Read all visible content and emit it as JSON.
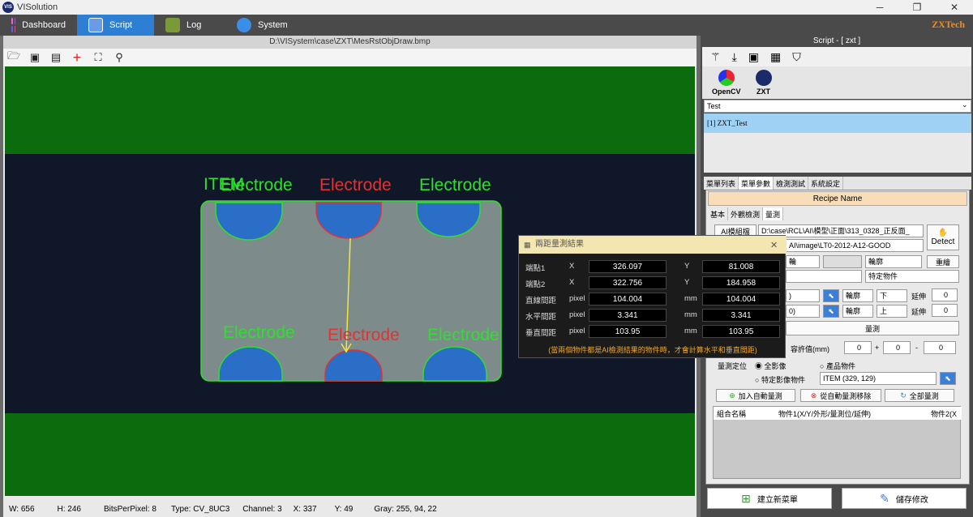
{
  "app": {
    "title": "VISolution",
    "logo_text": "VIS",
    "brand": "ZXTech",
    "win_minimize": "─",
    "win_restore": "❐",
    "win_close": "✕"
  },
  "menu": [
    {
      "label": "Dashboard",
      "icon": "dashboard-icon",
      "color": "#c04fc9"
    },
    {
      "label": "Script",
      "icon": "script-icon",
      "color": "#3a6bd6"
    },
    {
      "label": "Log",
      "icon": "log-icon",
      "color": "#7a9a3a"
    },
    {
      "label": "System",
      "icon": "gear-icon",
      "color": "#3a8ee6"
    }
  ],
  "viewer": {
    "path": "D:\\VISystem\\case\\ZXT\\MesRstObjDraw.bmp",
    "toolbar": [
      "open-folder-icon",
      "load-image-icon",
      "save-image-icon",
      "crosshair-icon",
      "fit-icon",
      "zoom-icon"
    ],
    "labels": {
      "item": "ITEM",
      "electrode": "Electrode"
    }
  },
  "status": {
    "w": "W:  656",
    "h": "H:  246",
    "bpp": "BitsPerPixel:  8",
    "type": "Type:  CV_8UC3",
    "channel": "Channel:  3",
    "x": "X:  337",
    "y": "Y:  49",
    "gray": "Gray:  255, 94, 22"
  },
  "script": {
    "header": "Script - [ zxt ]",
    "libs": [
      {
        "label": "OpenCV"
      },
      {
        "label": "ZXT"
      }
    ],
    "combo": "Test",
    "list_item": "[1] ZXT_Test",
    "tabs": [
      "菜單列表",
      "菜單參數",
      "檢測測試",
      "系統設定"
    ],
    "recipe_name": "Recipe Name",
    "subtabs": [
      "基本",
      "外觀檢測",
      "量測"
    ],
    "ai_model_btn": "AI模組檔",
    "ai_model_path": "D:\\case\\RCL\\AI\\模型\\正面\\313_0328_正反面_",
    "image_path": "AI\\image\\LT0-2012-A12-GOOD",
    "detect": "Detect",
    "row3": {
      "c1": "輪",
      "c2": "輪廓",
      "btn": "重繪"
    },
    "row4": {
      "c1": "",
      "c2": "特定物件"
    },
    "row5": {
      "c1": ")",
      "c2": "輪廓",
      "c3": "下",
      "lbl": "延伸",
      "val": "0"
    },
    "row6": {
      "c1": "0)",
      "c2": "輪廓",
      "c3": "上",
      "lbl": "延伸",
      "val": "0"
    },
    "measure_btn": "量測",
    "tol_label": "容許值(mm)",
    "tol_vals": [
      "0",
      "0",
      "0"
    ],
    "tol_plus": "+",
    "tol_minus": "-",
    "pos_label": "量測定位",
    "radio1": "全影像",
    "radio2": "產品物件",
    "radio3": "特定影像物件",
    "item_combo": "ITEM (329, 129)",
    "add_auto": "加入自動量測",
    "remove_auto": "從自動量測移除",
    "all_measure": "全部量測",
    "table_headers": [
      "組合名稱",
      "物件1(X/Y/外形/量測位/延伸)",
      "物件2(X"
    ],
    "new_menu": "建立新菜單",
    "save": "儲存修改"
  },
  "dialog": {
    "title": "兩距量測結果",
    "close": "✕",
    "rows": [
      {
        "label": "端點1",
        "u1": "X",
        "v1": "326.097",
        "u2": "Y",
        "v2": "81.008"
      },
      {
        "label": "端點2",
        "u1": "X",
        "v1": "322.756",
        "u2": "Y",
        "v2": "184.958"
      },
      {
        "label": "直線間距",
        "u1": "pixel",
        "v1": "104.004",
        "u2": "mm",
        "v2": "104.004"
      },
      {
        "label": "水平間距",
        "u1": "pixel",
        "v1": "3.341",
        "u2": "mm",
        "v2": "3.341"
      },
      {
        "label": "垂直間距",
        "u1": "pixel",
        "v1": "103.95",
        "u2": "mm",
        "v2": "103.95"
      }
    ],
    "note": "(當兩個物件都是AI檢測結果的物件時，才會計算水平和垂直間距)"
  }
}
